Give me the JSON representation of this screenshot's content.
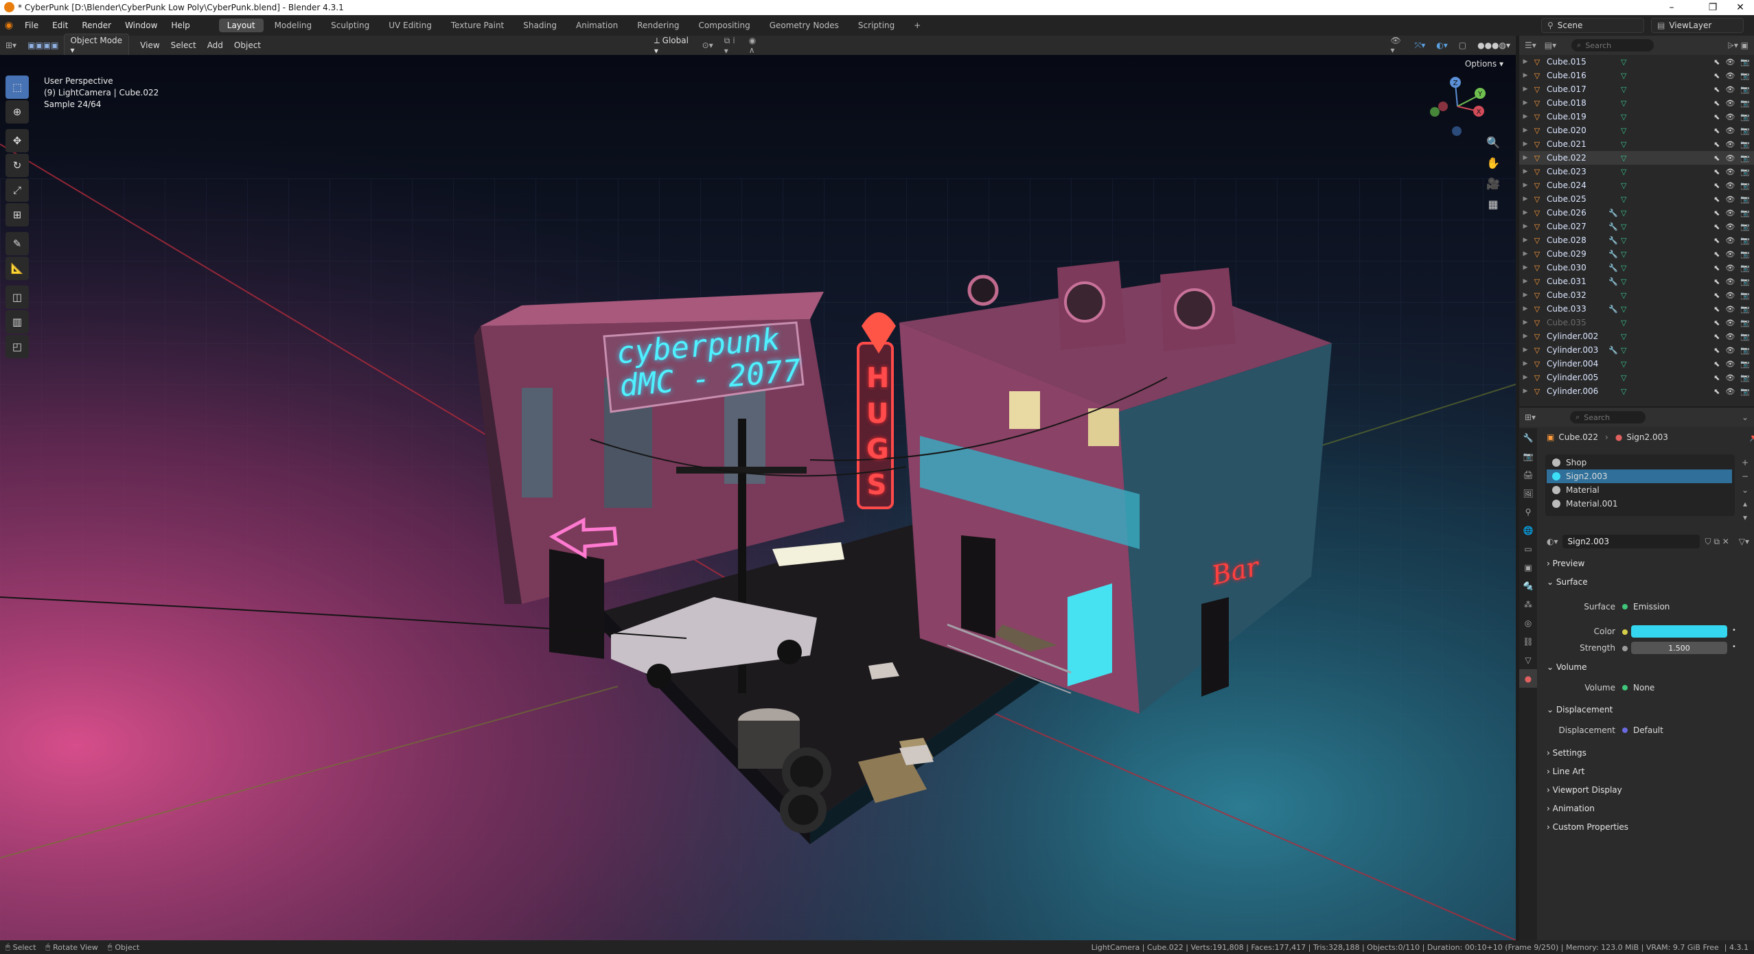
{
  "window": {
    "title": "* CyberPunk [D:\\Blender\\CyberPunk Low Poly\\CyberPunk.blend] - Blender 4.3.1",
    "controls": [
      "–",
      "❐",
      "✕"
    ]
  },
  "menus": [
    "File",
    "Edit",
    "Render",
    "Window",
    "Help"
  ],
  "workspaces": [
    "Layout",
    "Modeling",
    "Sculpting",
    "UV Editing",
    "Texture Paint",
    "Shading",
    "Animation",
    "Rendering",
    "Compositing",
    "Geometry Nodes",
    "Scripting"
  ],
  "active_workspace": "Layout",
  "scene": "Scene",
  "view_layer": "ViewLayer",
  "viewport_header": {
    "mode": "Object Mode",
    "menus": [
      "View",
      "Select",
      "Add",
      "Object"
    ],
    "orientation": "Global",
    "options": "Options"
  },
  "viewport_info": {
    "line1": "User Perspective",
    "line2": "(9) LightCamera | Cube.022",
    "line3": "Sample 24/64"
  },
  "scene_text": {
    "sign_line1": "cyberpunk",
    "sign_line2": "dMC - 2077",
    "hugs": [
      "H",
      "U",
      "G",
      "S"
    ],
    "bar": "Bar"
  },
  "gizmo": {
    "x": "X",
    "y": "Y",
    "z": "Z"
  },
  "outliner": {
    "search_placeholder": "Search",
    "items": [
      {
        "name": "Cube.015",
        "mod": false
      },
      {
        "name": "Cube.016",
        "mod": false
      },
      {
        "name": "Cube.017",
        "mod": false
      },
      {
        "name": "Cube.018",
        "mod": false
      },
      {
        "name": "Cube.019",
        "mod": false
      },
      {
        "name": "Cube.020",
        "mod": false
      },
      {
        "name": "Cube.021",
        "mod": false
      },
      {
        "name": "Cube.022",
        "mod": false,
        "selected": true
      },
      {
        "name": "Cube.023",
        "mod": false
      },
      {
        "name": "Cube.024",
        "mod": false
      },
      {
        "name": "Cube.025",
        "mod": false
      },
      {
        "name": "Cube.026",
        "mod": true
      },
      {
        "name": "Cube.027",
        "mod": true
      },
      {
        "name": "Cube.028",
        "mod": true
      },
      {
        "name": "Cube.029",
        "mod": true
      },
      {
        "name": "Cube.030",
        "mod": true
      },
      {
        "name": "Cube.031",
        "mod": true
      },
      {
        "name": "Cube.032",
        "mod": false
      },
      {
        "name": "Cube.033",
        "mod": true
      },
      {
        "name": "Cube.035",
        "mod": false,
        "dim": true
      },
      {
        "name": "Cylinder.002",
        "mod": false
      },
      {
        "name": "Cylinder.003",
        "mod": true
      },
      {
        "name": "Cylinder.004",
        "mod": false
      },
      {
        "name": "Cylinder.005",
        "mod": false
      },
      {
        "name": "Cylinder.006",
        "mod": false
      }
    ]
  },
  "properties": {
    "search_placeholder": "Search",
    "breadcrumb_object": "Cube.022",
    "breadcrumb_material": "Sign2.003",
    "slots": [
      "Shop",
      "Sign2.003",
      "Material",
      "Material.001"
    ],
    "active_slot": 1,
    "material_name": "Sign2.003",
    "panels": {
      "preview": "Preview",
      "surface": "Surface",
      "volume": "Volume",
      "displacement": "Displacement",
      "settings": "Settings",
      "line_art": "Line Art",
      "viewport_display": "Viewport Display",
      "animation": "Animation",
      "custom_properties": "Custom Properties"
    },
    "surface_label": "Surface",
    "surface_value": "Emission",
    "color_label": "Color",
    "color_value": "#35d7f0",
    "strength_label": "Strength",
    "strength_value": "1.500",
    "volume_label": "Volume",
    "volume_value": "None",
    "displacement_label": "Displacement",
    "displacement_value": "Default"
  },
  "statusbar": {
    "select": "Select",
    "rotate": "Rotate View",
    "object": "Object",
    "stats": "LightCamera | Cube.022 | Verts:191,808 | Faces:177,417 | Tris:328,188 | Objects:0/110 | Duration: 00:10+10 (Frame 9/250) | Memory: 123.0 MiB | VRAM: 9.7 GiB Free",
    "version": "4.3.1"
  },
  "colors": {
    "accent_blue": "#4772b3",
    "emission_cyan": "#35d7f0",
    "neon_pink": "#ff4fa8",
    "neon_red": "#ff3b3b"
  }
}
